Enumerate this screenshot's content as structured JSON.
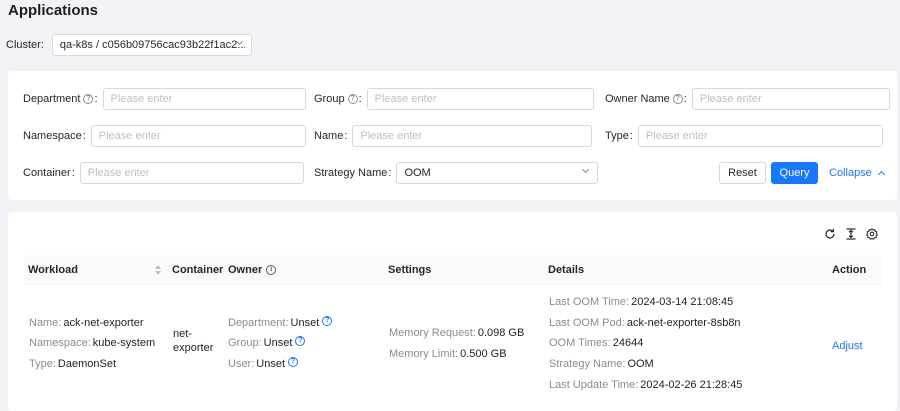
{
  "page": {
    "title": "Applications"
  },
  "cluster": {
    "label": "Cluster",
    "value": "qa-k8s / c056b09756cac93b22f1ac2..."
  },
  "filters": {
    "placeholder": "Please enter",
    "department_label": "Department",
    "group_label": "Group",
    "owner_name_label": "Owner Name",
    "namespace_label": "Namespace",
    "name_label": "Name",
    "type_label": "Type",
    "container_label": "Container",
    "strategy_label": "Strategy Name",
    "strategy_value": "OOM"
  },
  "actions": {
    "reset": "Reset",
    "query": "Query",
    "collapse": "Collapse"
  },
  "toolbar": {
    "icons": [
      "refresh-icon",
      "column-height-icon",
      "settings-icon"
    ]
  },
  "table": {
    "headers": {
      "workload": "Workload",
      "container": "Container",
      "owner": "Owner",
      "settings": "Settings",
      "details": "Details",
      "action": "Action"
    },
    "rows": [
      {
        "workload": {
          "name_key": "Name",
          "name": "ack-net-exporter",
          "namespace_key": "Namespace",
          "namespace": "kube-system",
          "type_key": "Type",
          "type": "DaemonSet"
        },
        "container": "net-exporter",
        "owner": {
          "department_key": "Department",
          "department": "Unset",
          "group_key": "Group",
          "group": "Unset",
          "user_key": "User",
          "user": "Unset"
        },
        "settings": {
          "memory_request_key": "Memory Request",
          "memory_request": "0.098 GB",
          "memory_limit_key": "Memory Limit",
          "memory_limit": "0.500 GB"
        },
        "details": {
          "last_oom_time_key": "Last OOM Time",
          "last_oom_time": "2024-03-14 21:08:45",
          "last_oom_pod_key": "Last OOM Pod",
          "last_oom_pod": "ack-net-exporter-8sb8n",
          "oom_times_key": "OOM Times",
          "oom_times": "24644",
          "strategy_name_key": "Strategy Name",
          "strategy_name": "OOM",
          "last_update_time_key": "Last Update Time",
          "last_update_time": "2024-02-26 21:28:45"
        },
        "action": "Adjust"
      }
    ]
  },
  "colors": {
    "primary": "#1677ff",
    "background": "#f0f2f5",
    "border": "#d9d9d9"
  }
}
